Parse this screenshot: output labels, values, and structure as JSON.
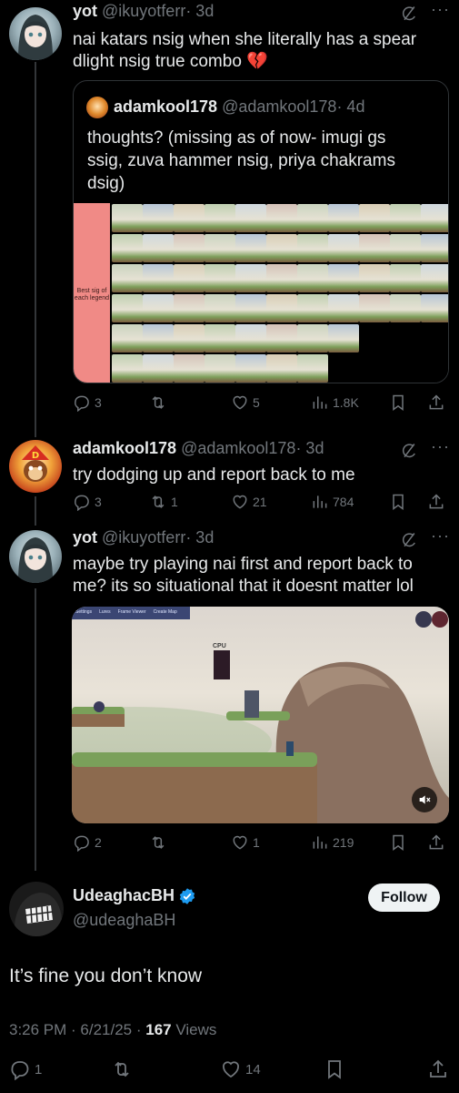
{
  "colors": {
    "accent": "#1d9bf0",
    "text": "#e7e9ea",
    "muted": "#71767b",
    "bg": "#000000",
    "broken_heart": "#f91880"
  },
  "reply1": {
    "name": "yot",
    "handle": "@ikuyotferr",
    "time": "· 3d",
    "text_line1": "nai katars nsig when she literally has a spear",
    "text_line2": "dlight nsig true combo 💔",
    "quote": {
      "name": "adamkool178",
      "handle": "@adamkool178",
      "time": "· 4d",
      "text_line1": "thoughts? (missing as of now- imugi gs",
      "text_line2": "ssig, zuva hammer nsig, priya chakrams",
      "text_line3": "dsig)",
      "tier_label_line1": "Best sig of",
      "tier_label_line2": "each legend"
    },
    "stats": {
      "replies": "3",
      "reposts": "",
      "likes": "5",
      "views": "1.8K"
    }
  },
  "reply2": {
    "name": "adamkool178",
    "handle": "@adamkool178",
    "time": "· 3d",
    "text": "try dodging up and report back to me",
    "stats": {
      "replies": "3",
      "reposts": "1",
      "likes": "21",
      "views": "784"
    }
  },
  "reply3": {
    "name": "yot",
    "handle": "@ikuyotferr",
    "time": "· 3d",
    "text_line1": "maybe try playing nai first and report back to",
    "text_line2": "me? its so situational that it doesnt matter lol",
    "video": {
      "menu": [
        "Settings",
        "Lures",
        "Frame Viewer",
        "Create Map"
      ],
      "cpu_tag": "CPU"
    },
    "stats": {
      "replies": "2",
      "reposts": "",
      "likes": "1",
      "views": "219"
    }
  },
  "main": {
    "name": "UdeaghacBH",
    "handle": "@udeaghaBH",
    "follow_label": "Follow",
    "text": "It’s fine you don’t know",
    "time": "3:26 PM · 6/21/25 ·",
    "views_count": "167",
    "views_label": "Views",
    "stats": {
      "replies": "1",
      "likes": "14"
    }
  },
  "icons": [
    "grok-icon",
    "more-icon",
    "reply-icon",
    "repost-icon",
    "like-icon",
    "views-icon",
    "bookmark-icon",
    "share-icon",
    "verified-icon",
    "mute-icon"
  ]
}
